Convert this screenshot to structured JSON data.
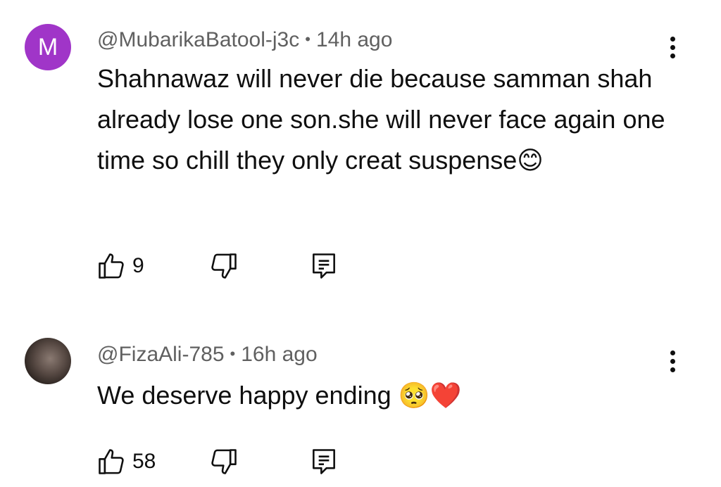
{
  "comments": [
    {
      "avatar_letter": "M",
      "avatar_color": "#a035c8",
      "handle": "@MubarikaBatool-j3c",
      "separator": "•",
      "time": "14h ago",
      "text": "Shahnawaz will never die because samman shah already lose one son.she will never face again one time so chill they only creat suspense😊",
      "likes": "9",
      "icons": [
        "thumbs-up-icon",
        "thumbs-down-icon",
        "reply-comment-icon",
        "more-vert-icon"
      ]
    },
    {
      "avatar_letter": "",
      "handle": "@FizaAli-785",
      "separator": "•",
      "time": "16h ago",
      "text": "We deserve happy ending 🥺❤️",
      "likes": "58",
      "icons": [
        "thumbs-up-icon",
        "thumbs-down-icon",
        "reply-comment-icon",
        "more-vert-icon"
      ]
    }
  ]
}
